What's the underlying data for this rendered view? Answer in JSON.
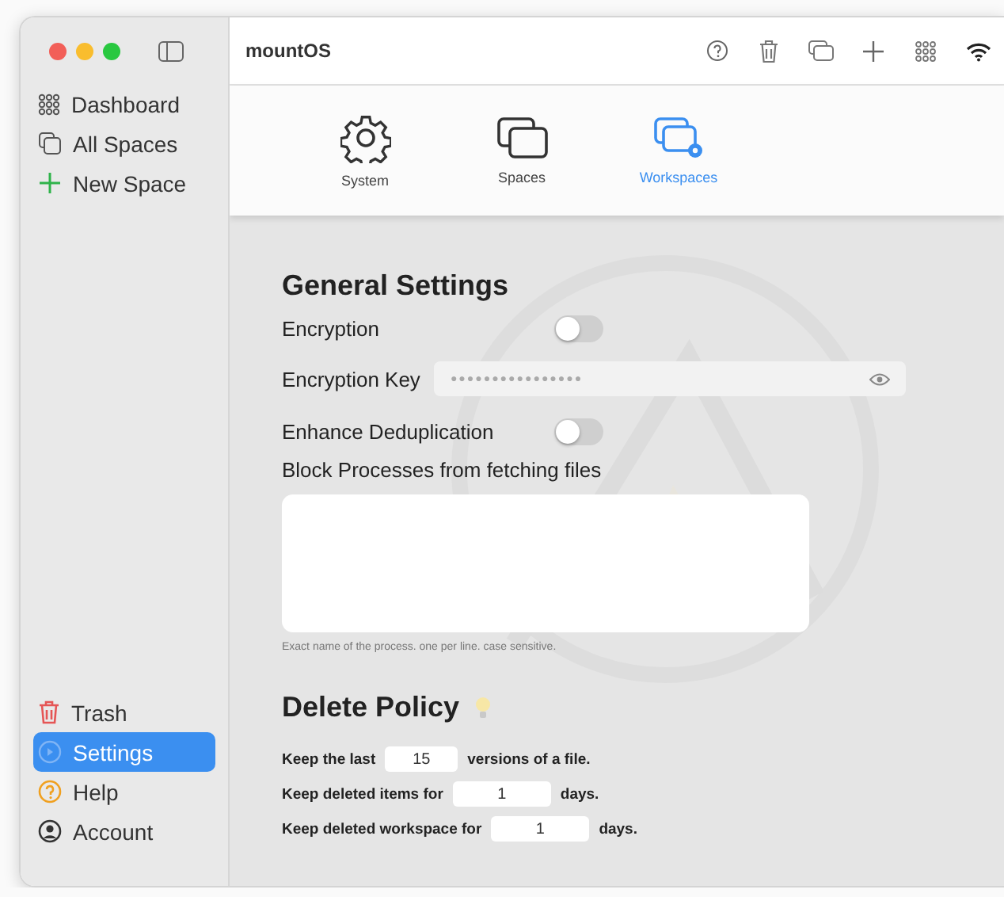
{
  "window": {
    "title": "mountOS"
  },
  "sidebar": {
    "top_items": [
      {
        "label": "Dashboard",
        "selected": false
      },
      {
        "label": "All Spaces",
        "selected": false
      },
      {
        "label": "New Space",
        "selected": false
      }
    ],
    "bottom_items": [
      {
        "label": "Trash",
        "selected": false
      },
      {
        "label": "Settings",
        "selected": true
      },
      {
        "label": "Help",
        "selected": false
      },
      {
        "label": "Account",
        "selected": false
      }
    ]
  },
  "tabs": [
    {
      "label": "System",
      "selected": false
    },
    {
      "label": "Spaces",
      "selected": false
    },
    {
      "label": "Workspaces",
      "selected": true
    }
  ],
  "general": {
    "title": "General Settings",
    "encryption": {
      "label": "Encryption",
      "on": false
    },
    "encryption_key": {
      "label": "Encryption Key",
      "value": "●●●●●●●●●●●●●●●●"
    },
    "deduplication": {
      "label": "Enhance Deduplication",
      "on": false
    },
    "block_processes": {
      "label": "Block Processes from fetching files",
      "hint": "Exact name of the process. one per line. case sensitive."
    }
  },
  "delete_policy": {
    "title": "Delete Policy",
    "rows": [
      {
        "prefix": "Keep the last",
        "value": "15",
        "suffix": "versions of a file."
      },
      {
        "prefix": "Keep deleted items for",
        "value": "1",
        "suffix": "days."
      },
      {
        "prefix": "Keep deleted workspace for",
        "value": "1",
        "suffix": "days."
      }
    ]
  }
}
